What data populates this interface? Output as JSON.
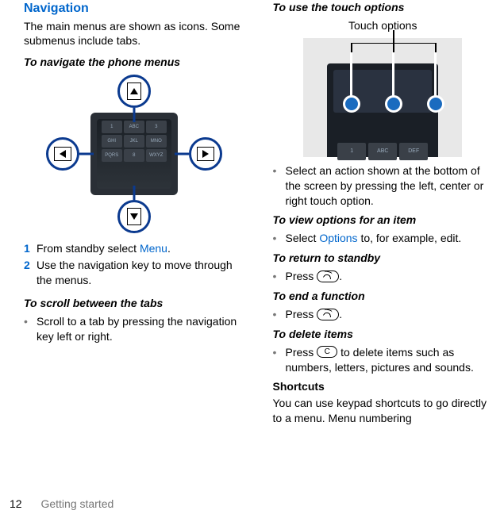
{
  "left": {
    "navigation_heading": "Navigation",
    "navigation_para": "The main menus are shown as icons. Some submenus include tabs.",
    "to_navigate_heading": "To navigate the phone menus",
    "step1_num": "1",
    "step1_before": "From standby select ",
    "step1_link": "Menu",
    "step1_after": ".",
    "step2_num": "2",
    "step2_text": "Use the navigation key to move through the menus.",
    "scroll_heading": "To scroll between the tabs",
    "scroll_bullet": "Scroll to a tab by pressing the navigation key left or right."
  },
  "right": {
    "touch_heading": "To use the touch options",
    "touch_label": "Touch options",
    "select_bullet": "Select an action shown at the bottom of the screen by pressing the left, center or right touch option.",
    "view_heading": "To view options for an item",
    "view_before": "Select ",
    "view_link": "Options",
    "view_after": " to, for example, edit.",
    "return_heading": "To return to standby",
    "return_before": "Press ",
    "return_after": ".",
    "end_heading": "To end a function",
    "end_before": "Press ",
    "end_after": ".",
    "delete_heading": "To delete items",
    "delete_before": "Press ",
    "delete_key": "C",
    "delete_after": " to delete items such as numbers, letters, pictures and sounds.",
    "shortcuts_heading": "Shortcuts",
    "shortcuts_para": "You can use keypad shortcuts to go directly to a menu. Menu numbering"
  },
  "footer": {
    "page": "12",
    "section": "Getting started"
  }
}
